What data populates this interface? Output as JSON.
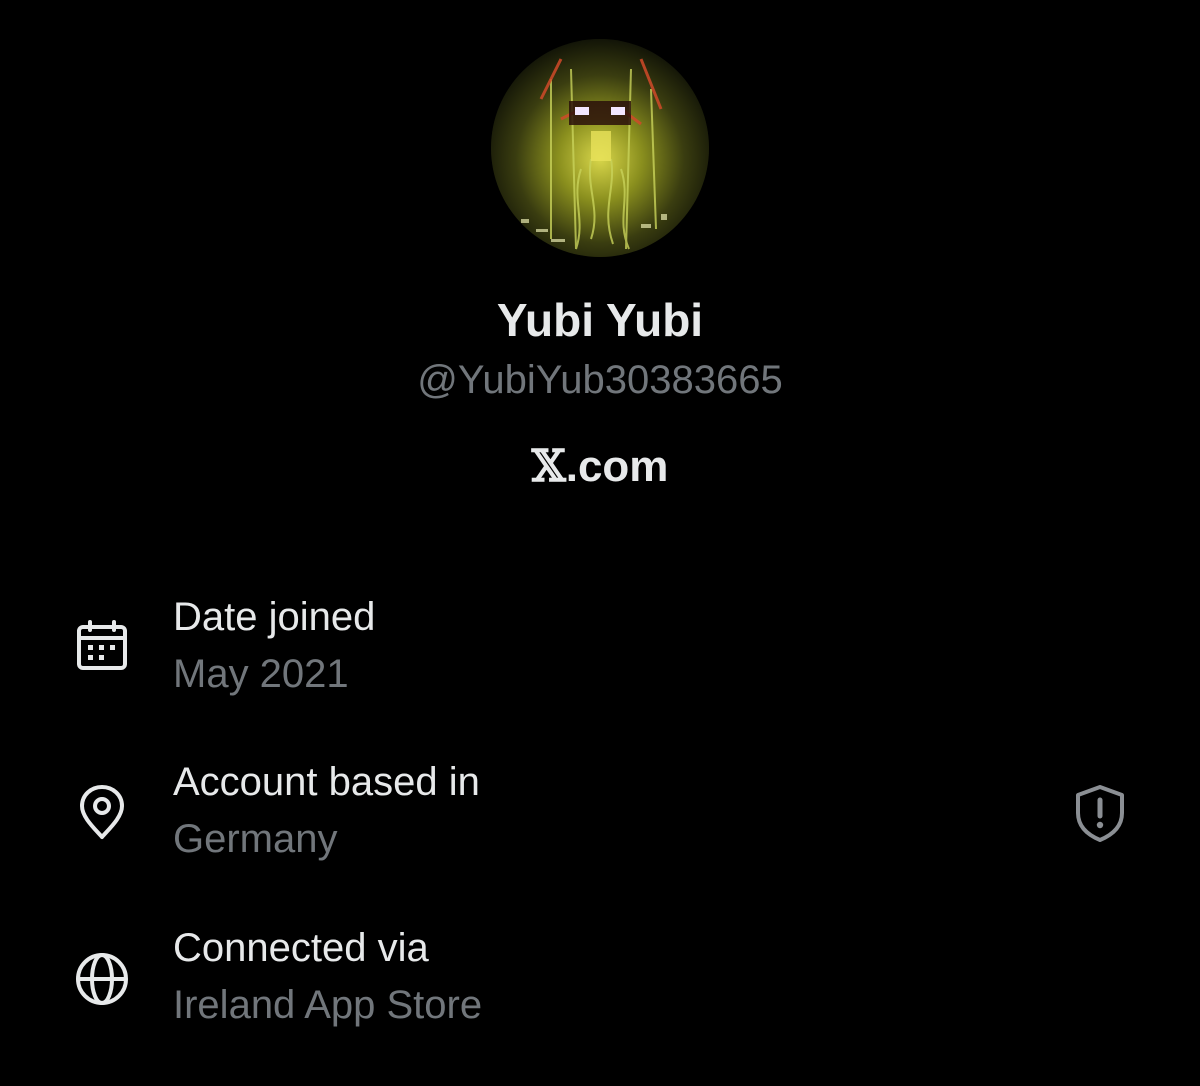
{
  "profile": {
    "display_name": "Yubi Yubi",
    "handle": "@YubiYub30383665",
    "brand_symbol": "𝕏",
    "brand_suffix": ".com"
  },
  "about": {
    "date_joined": {
      "label": "Date joined",
      "value": "May 2021",
      "icon": "calendar-icon"
    },
    "account_based_in": {
      "label": "Account based in",
      "value": "Germany",
      "icon": "location-pin-icon",
      "trailing_icon": "shield-alert-icon"
    },
    "connected_via": {
      "label": "Connected via",
      "value": "Ireland App Store",
      "icon": "globe-icon"
    }
  },
  "colors": {
    "background": "#000000",
    "primary_text": "#e7e9ea",
    "secondary_text": "#71767b"
  }
}
